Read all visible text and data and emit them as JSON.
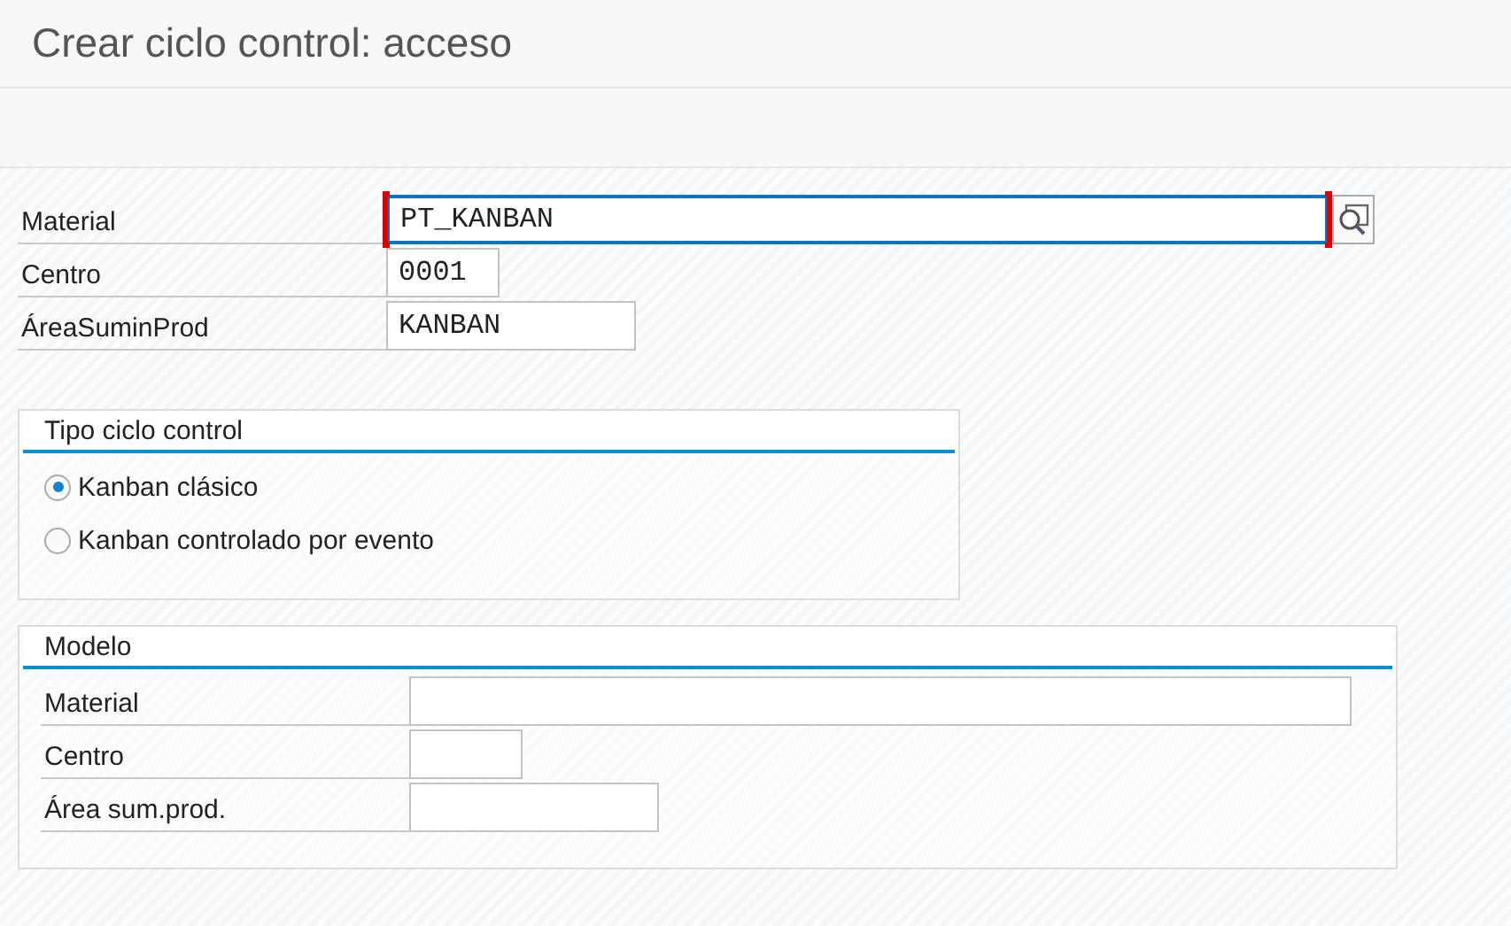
{
  "window": {
    "title": "Crear ciclo control: acceso"
  },
  "fields": [
    {
      "label": "Material",
      "value": "PT_KANBAN",
      "focused": true,
      "search_help": true
    },
    {
      "label": "Centro",
      "value": "0001",
      "focused": false,
      "search_help": false
    },
    {
      "label": "ÁreaSuminProd",
      "value": "KANBAN",
      "focused": false,
      "search_help": false
    }
  ],
  "cycle_type": {
    "title": "Tipo ciclo control",
    "options": [
      {
        "label": "Kanban clásico",
        "selected": true
      },
      {
        "label": "Kanban controlado por evento",
        "selected": false
      }
    ]
  },
  "model": {
    "title": "Modelo",
    "fields": [
      {
        "label": "Material"
      },
      {
        "label": "Centro"
      },
      {
        "label": "Área sum.prod."
      }
    ]
  }
}
